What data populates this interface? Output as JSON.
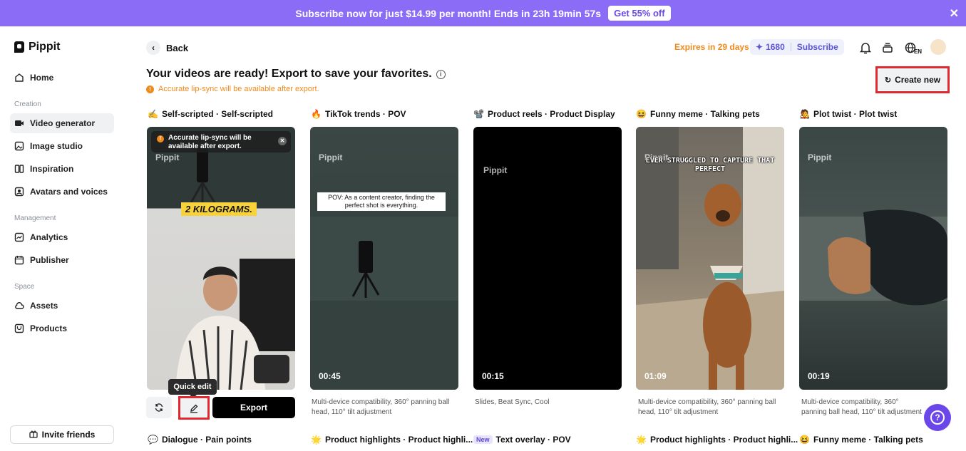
{
  "banner": {
    "text": "Subscribe now for just $14.99 per month! Ends in 23h 19min 57s",
    "cta": "Get 55% off"
  },
  "sidebar": {
    "logo": "Pippit",
    "home": "Home",
    "creation_label": "Creation",
    "creation": [
      "Video generator",
      "Image studio",
      "Inspiration",
      "Avatars and voices"
    ],
    "management_label": "Management",
    "management": [
      "Analytics",
      "Publisher"
    ],
    "space_label": "Space",
    "space": [
      "Assets",
      "Products"
    ],
    "invite": "Invite friends"
  },
  "topbar": {
    "back": "Back",
    "expires": "Expires in 29 days",
    "credits": "1680",
    "subscribe": "Subscribe",
    "lang": "EN"
  },
  "main": {
    "heading": "Your videos are ready! Export to save your favorites.",
    "note": "Accurate lip-sync will be available after export.",
    "create_new": "Create new"
  },
  "cards": [
    {
      "title": "Self-scripted · Self-scripted",
      "icon": "✍️",
      "toast": "Accurate lip-sync will be available after export.",
      "caption": "2 KILOGRAMS.",
      "watermark": "Pippit"
    },
    {
      "title": "TikTok trends · POV",
      "icon": "🔥",
      "duration": "00:45",
      "overlay": "POV: As a content creator, finding the perfect shot is everything.",
      "watermark": "Pippit",
      "desc": "Multi-device compatibility, 360° panning ball head, 110° tilt adjustment"
    },
    {
      "title": "Product reels · Product Display",
      "icon": "📽️",
      "duration": "00:15",
      "watermark": "Pippit",
      "desc": "Slides, Beat Sync, Cool"
    },
    {
      "title": "Funny meme · Talking pets",
      "icon": "😆",
      "duration": "01:09",
      "overlay": "EVER STRUGGLED TO CAPTURE THAT PERFECT",
      "watermark": "Pippit",
      "desc": "Multi-device compatibility, 360° panning ball head, 110° tilt adjustment"
    },
    {
      "title": "Plot twist · Plot twist",
      "icon": "🧑‍🎤",
      "duration": "00:19",
      "watermark": "Pippit",
      "desc": "Multi-device compatibility, 360° panning ball head, 110° tilt adjustment"
    }
  ],
  "card_actions": {
    "tooltip": "Quick edit",
    "export": "Export"
  },
  "row2": [
    {
      "title": "Dialogue · Pain points",
      "icon": "💬"
    },
    {
      "title": "Product highlights · Product highli...",
      "icon": "🌟"
    },
    {
      "title": "Text overlay · POV",
      "badge": "New"
    },
    {
      "title": "Product highlights · Product highli...",
      "icon": "🌟"
    },
    {
      "title": "Funny meme · Talking pets",
      "icon": "😆"
    }
  ]
}
